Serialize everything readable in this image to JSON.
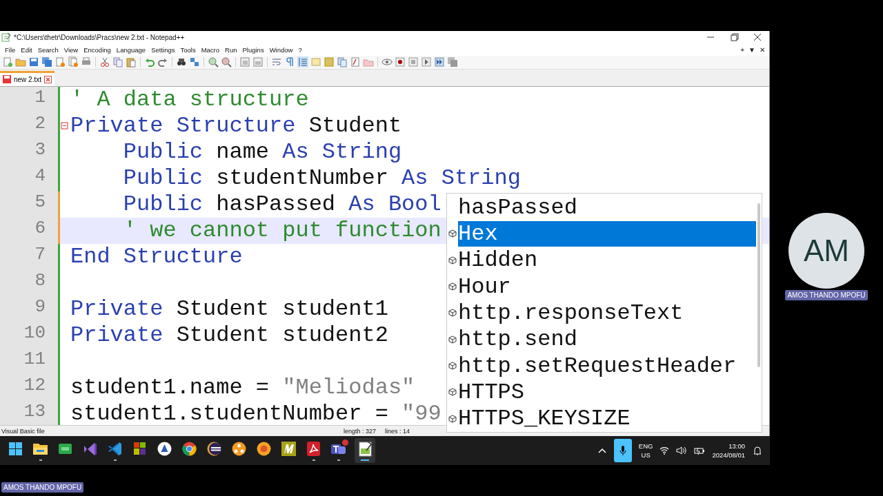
{
  "window": {
    "title": "*C:\\Users\\thetr\\Downloads\\Pracs\\new 2.txt - Notepad++"
  },
  "menu": [
    "File",
    "Edit",
    "Search",
    "View",
    "Encoding",
    "Language",
    "Settings",
    "Tools",
    "Macro",
    "Run",
    "Plugins",
    "Window",
    "?"
  ],
  "menu_controls": [
    "+",
    "▼",
    "✕"
  ],
  "tabs": [
    {
      "label": "new 2.txt",
      "selected": true
    }
  ],
  "editor": {
    "lines": [
      {
        "number": "1",
        "current": false,
        "fold_start": false,
        "modified": false,
        "tokens": [
          {
            "kind": "comment",
            "text": "' A data structure"
          }
        ]
      },
      {
        "number": "2",
        "current": false,
        "fold_start": true,
        "modified": false,
        "tokens": [
          {
            "kind": "keyword",
            "text": "Private Structure"
          },
          {
            "kind": "plain",
            "text": " Student"
          }
        ]
      },
      {
        "number": "3",
        "current": false,
        "fold_start": false,
        "modified": false,
        "tokens": [
          {
            "kind": "keyword",
            "text": "    Public"
          },
          {
            "kind": "plain",
            "text": " name "
          },
          {
            "kind": "keyword",
            "text": "As String"
          }
        ]
      },
      {
        "number": "4",
        "current": false,
        "fold_start": false,
        "modified": false,
        "tokens": [
          {
            "kind": "keyword",
            "text": "    Public"
          },
          {
            "kind": "plain",
            "text": " studentNumber "
          },
          {
            "kind": "keyword",
            "text": "As String"
          }
        ]
      },
      {
        "number": "5",
        "current": false,
        "fold_start": false,
        "modified": true,
        "tokens": [
          {
            "kind": "keyword",
            "text": "    Public"
          },
          {
            "kind": "plain",
            "text": " hasPassed "
          },
          {
            "kind": "keyword",
            "text": "As Bool"
          }
        ]
      },
      {
        "number": "6",
        "current": true,
        "fold_start": false,
        "modified": true,
        "tokens": [
          {
            "kind": "comment",
            "text": "    ' we cannot put function"
          }
        ]
      },
      {
        "number": "7",
        "current": false,
        "fold_start": false,
        "modified": false,
        "tokens": [
          {
            "kind": "keyword",
            "text": "End Structure"
          }
        ]
      },
      {
        "number": "8",
        "current": false,
        "fold_start": false,
        "modified": false
      },
      {
        "number": "9",
        "current": false,
        "fold_start": false,
        "modified": false,
        "tokens": [
          {
            "kind": "keyword",
            "text": "Private"
          },
          {
            "kind": "plain",
            "text": " Student student1"
          }
        ]
      },
      {
        "number": "10",
        "current": false,
        "fold_start": false,
        "modified": false,
        "tokens": [
          {
            "kind": "keyword",
            "text": "Private"
          },
          {
            "kind": "plain",
            "text": " Student student2"
          }
        ]
      },
      {
        "number": "11",
        "current": false,
        "fold_start": false,
        "modified": false
      },
      {
        "number": "12",
        "current": false,
        "fold_start": false,
        "modified": false,
        "tokens": [
          {
            "kind": "plain",
            "text": "student1.name = "
          },
          {
            "kind": "string",
            "text": "\"Meliodas\""
          }
        ]
      },
      {
        "number": "13",
        "current": false,
        "fold_start": false,
        "modified": false,
        "tokens": [
          {
            "kind": "plain",
            "text": "student1.studentNumber = "
          },
          {
            "kind": "string",
            "text": "\"99"
          }
        ]
      }
    ]
  },
  "autocomplete": [
    {
      "label": "hasPassed",
      "kind": "word",
      "selected": false
    },
    {
      "label": "Hex",
      "kind": "member",
      "selected": true
    },
    {
      "label": "Hidden",
      "kind": "member",
      "selected": false
    },
    {
      "label": "Hour",
      "kind": "member",
      "selected": false
    },
    {
      "label": "http.responseText",
      "kind": "member",
      "selected": false
    },
    {
      "label": "http.send",
      "kind": "member",
      "selected": false
    },
    {
      "label": "http.setRequestHeader",
      "kind": "member",
      "selected": false
    },
    {
      "label": "HTTPS",
      "kind": "member",
      "selected": false
    },
    {
      "label": "HTTPS_KEYSIZE",
      "kind": "member",
      "selected": false
    }
  ],
  "status_bar": {
    "file_type": "Visual Basic file",
    "length": "length : 327",
    "lines": "lines : 14"
  },
  "taskbar": {
    "apps": [
      {
        "kind": "start",
        "running": false,
        "active": false
      },
      {
        "kind": "folder",
        "running": true,
        "active": false
      },
      {
        "kind": "qc",
        "running": false,
        "active": false
      },
      {
        "kind": "vs",
        "running": false,
        "active": false
      },
      {
        "kind": "vscode",
        "running": true,
        "active": false
      },
      {
        "kind": "tiles",
        "running": false,
        "active": false
      },
      {
        "kind": "badge",
        "running": false,
        "active": false
      },
      {
        "kind": "chrome",
        "running": false,
        "active": false
      },
      {
        "kind": "eclipse",
        "running": false,
        "active": false
      },
      {
        "kind": "orange",
        "running": false,
        "active": false
      },
      {
        "kind": "flower",
        "running": false,
        "active": false
      },
      {
        "kind": "mark",
        "running": false,
        "active": false
      },
      {
        "kind": "pdf",
        "running": true,
        "active": false
      },
      {
        "kind": "teams",
        "running": true,
        "active": false
      },
      {
        "kind": "notepad",
        "running": true,
        "active": true
      }
    ],
    "language": "ENG",
    "region": "US",
    "time": "13:00",
    "date": "2024/08/01"
  },
  "participant": {
    "initials": "AM",
    "name": "AMOS THANDO MPOFU"
  },
  "presenter_tag": "AMOS THANDO MPOFU"
}
